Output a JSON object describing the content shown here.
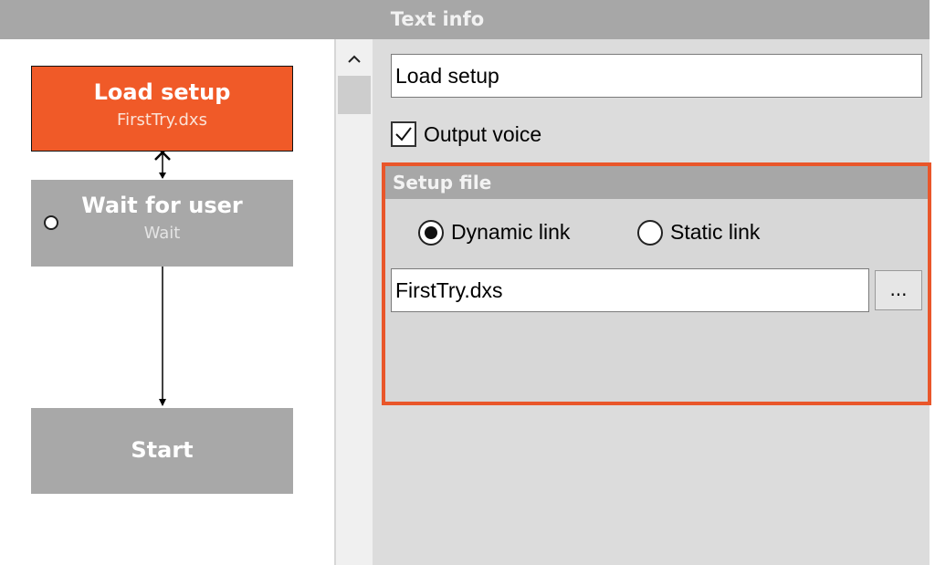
{
  "header": {
    "title": "Text info"
  },
  "flow": {
    "nodes": [
      {
        "title": "Load setup",
        "subtitle": "FirstTry.dxs",
        "color": "#f05a28"
      },
      {
        "title": "Wait for user",
        "subtitle": "Wait",
        "color": "#a8a8a8"
      },
      {
        "title": "Start",
        "subtitle": "",
        "color": "#a8a8a8"
      }
    ]
  },
  "scrollbar": {
    "up_icon": "chevron-up-icon",
    "up_glyph": "⌃"
  },
  "properties": {
    "text_value": "Load setup",
    "output_voice": {
      "label": "Output voice",
      "checked": true
    },
    "setup_file": {
      "heading": "Setup file",
      "accent_color": "#e9562a",
      "options": [
        {
          "label": "Dynamic link",
          "selected": true
        },
        {
          "label": "Static link",
          "selected": false
        }
      ],
      "file_value": "FirstTry.dxs",
      "browse_label": "..."
    }
  }
}
